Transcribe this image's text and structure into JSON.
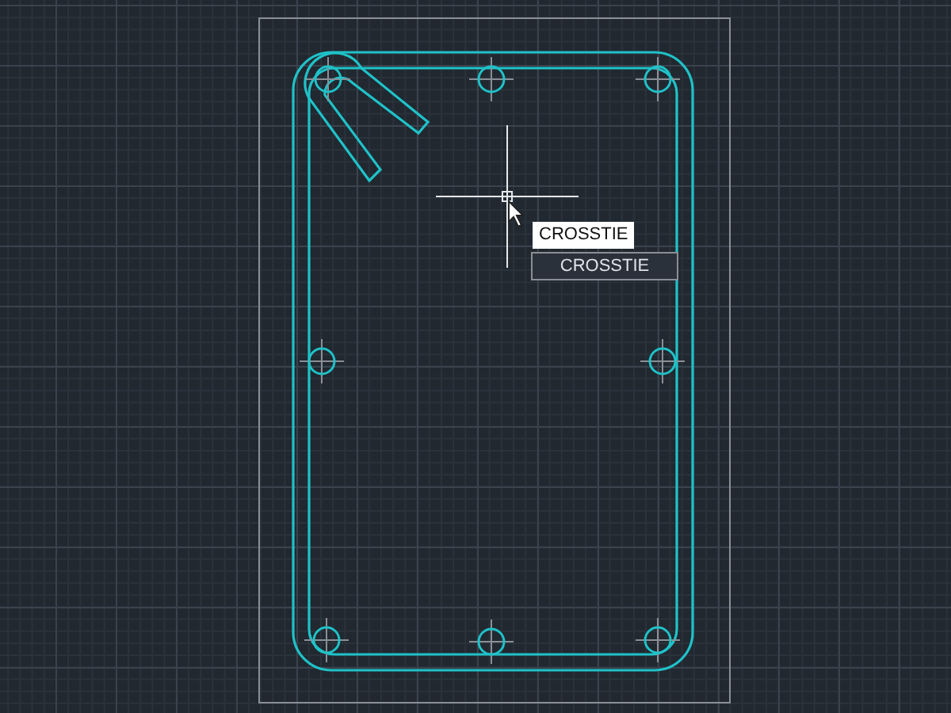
{
  "command_input": {
    "value": "CROSSTIE"
  },
  "suggestions": [
    {
      "label": "CROSSTIE"
    }
  ]
}
